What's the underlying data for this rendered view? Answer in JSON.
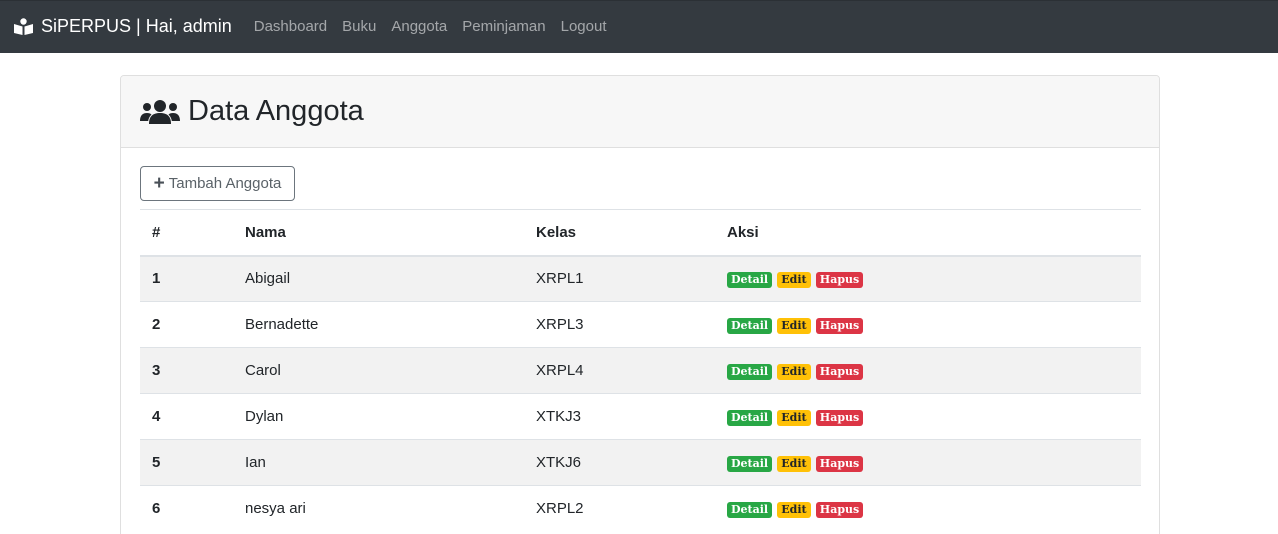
{
  "navbar": {
    "brand": "SiPERPUS | Hai, admin",
    "brand_icon": "book-reader-icon",
    "links": [
      "Dashboard",
      "Buku",
      "Anggota",
      "Peminjaman",
      "Logout"
    ]
  },
  "page": {
    "title": "Data Anggota",
    "title_icon": "users-icon",
    "add_button": "Tambah Anggota"
  },
  "table": {
    "headers": [
      "#",
      "Nama",
      "Kelas",
      "Aksi"
    ],
    "rows": [
      {
        "no": "1",
        "nama": "Abigail",
        "kelas": "XRPL1"
      },
      {
        "no": "2",
        "nama": "Bernadette",
        "kelas": "XRPL3"
      },
      {
        "no": "3",
        "nama": "Carol",
        "kelas": "XRPL4"
      },
      {
        "no": "4",
        "nama": "Dylan",
        "kelas": "XTKJ3"
      },
      {
        "no": "5",
        "nama": "Ian",
        "kelas": "XTKJ6"
      },
      {
        "no": "6",
        "nama": "nesya ari",
        "kelas": "XRPL2"
      }
    ],
    "actions": {
      "detail": "Detail",
      "edit": "Edit",
      "hapus": "Hapus"
    }
  },
  "colors": {
    "navbar": "#343a40",
    "detail": "#28a745",
    "edit": "#ffc107",
    "hapus": "#dc3545"
  }
}
